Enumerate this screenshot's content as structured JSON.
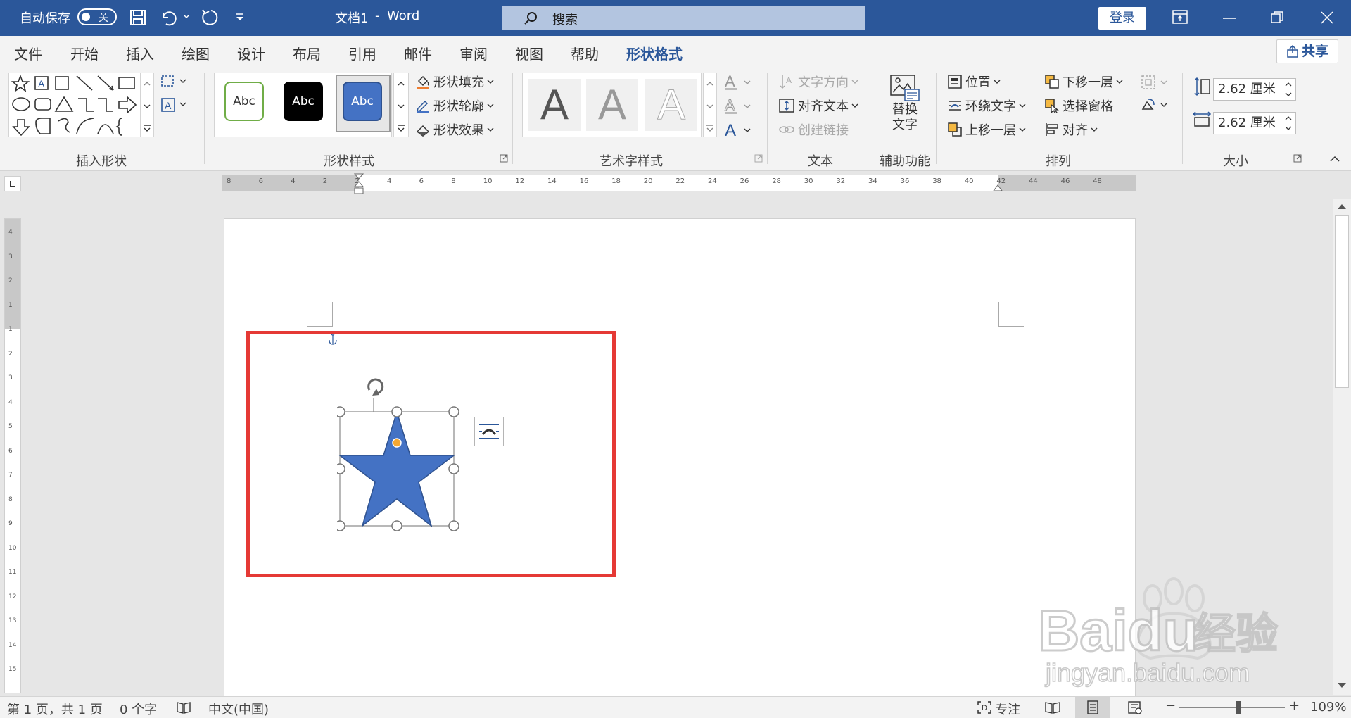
{
  "titlebar": {
    "autosave_label": "自动保存",
    "autosave_state": "关",
    "doc_title": "文档1",
    "separator": "-",
    "app_name": "Word",
    "search_placeholder": "搜索",
    "login_label": "登录"
  },
  "tabs": [
    "文件",
    "开始",
    "插入",
    "绘图",
    "设计",
    "布局",
    "引用",
    "邮件",
    "审阅",
    "视图",
    "帮助",
    "形状格式"
  ],
  "active_tab": "形状格式",
  "share_label": "共享",
  "ribbon": {
    "insert_shapes": {
      "label": "插入形状"
    },
    "shape_styles": {
      "label": "形状样式",
      "presets": [
        "Abc",
        "Abc",
        "Abc"
      ],
      "fill": "形状填充",
      "outline": "形状轮廓",
      "effects": "形状效果"
    },
    "wordart": {
      "label": "艺术字样式",
      "glyph": "A"
    },
    "text": {
      "label": "文本",
      "direction": "文字方向",
      "align": "对齐文本",
      "link": "创建链接"
    },
    "accessibility": {
      "label": "辅助功能",
      "alt_text_line1": "替换",
      "alt_text_line2": "文字"
    },
    "arrange": {
      "label": "排列",
      "position": "位置",
      "wrap": "环绕文字",
      "forward": "上移一层",
      "backward": "下移一层",
      "selection_pane": "选择窗格",
      "align": "对齐"
    },
    "size": {
      "label": "大小",
      "height": "2.62 厘米",
      "width": "2.62 厘米"
    }
  },
  "ruler_numbers": [
    "8",
    "6",
    "4",
    "2",
    "2",
    "4",
    "6",
    "8",
    "10",
    "12",
    "14",
    "16",
    "18",
    "20",
    "22",
    "24",
    "26",
    "28",
    "30",
    "32",
    "34",
    "36",
    "38",
    "40",
    "42",
    "44",
    "46",
    "48"
  ],
  "vruler_numbers": [
    "4",
    "3",
    "2",
    "1",
    "1",
    "2",
    "3",
    "4",
    "5",
    "6",
    "7",
    "8",
    "9",
    "10",
    "11",
    "12",
    "13",
    "14",
    "15"
  ],
  "shape": {
    "type": "star",
    "fill": "#4472c4",
    "stroke": "#2f528f"
  },
  "status": {
    "page": "第 1 页，共 1 页",
    "words": "0 个字",
    "language": "中文(中国)",
    "focus": "专注",
    "zoom_minus": "−",
    "zoom_plus": "+",
    "zoom": "109%"
  },
  "watermark": {
    "brand": "Baidu",
    "brand_cn": "经验",
    "url": "jingyan.baidu.com"
  },
  "colors": {
    "title_bg": "#2b579a",
    "highlight": "#e53935",
    "star": "#4472c4"
  }
}
